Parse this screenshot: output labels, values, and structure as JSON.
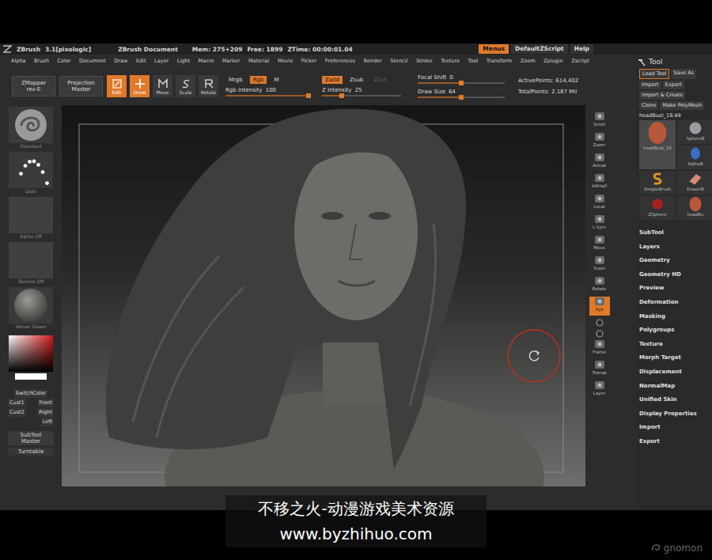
{
  "title_bar": {
    "app": "ZBrush",
    "version": "3.1[pixologic]",
    "document": "ZBrush Document",
    "mem": "Mem: 275+209",
    "free": "Free: 1899",
    "ztime": "ZTime: 00:00:01.04",
    "buttons": [
      {
        "label": "Menus",
        "selected": true
      },
      {
        "label": "DefaultZScript",
        "selected": false
      },
      {
        "label": "Help",
        "selected": false
      }
    ]
  },
  "menu": [
    "Alpha",
    "Brush",
    "Color",
    "Document",
    "Draw",
    "Edit",
    "Layer",
    "Light",
    "Macro",
    "Marker",
    "Material",
    "Movie",
    "Picker",
    "Preferences",
    "Render",
    "Stencil",
    "Stroke",
    "Texture",
    "Tool",
    "Transform",
    "Zoom",
    "Zplugin",
    "Zscript"
  ],
  "top_shelf": {
    "zmapper": [
      "ZMapper",
      "rev-E"
    ],
    "projection": [
      "Projection",
      "Master"
    ],
    "modes": [
      {
        "label": "Edit",
        "selected": true
      },
      {
        "label": "Draw",
        "selected": true
      },
      {
        "label": "Move",
        "selected": false
      },
      {
        "label": "Scale",
        "selected": false
      },
      {
        "label": "Rotate",
        "selected": false
      }
    ],
    "rgb": {
      "modes": [
        {
          "label": "Mrgb",
          "selected": false,
          "disabled": false
        },
        {
          "label": "Rgb",
          "selected": true,
          "disabled": false
        },
        {
          "label": "M",
          "selected": false,
          "disabled": false
        }
      ],
      "slider": {
        "label": "Rgb Intensity",
        "reading": "100",
        "level": 1
      }
    },
    "z": {
      "modes": [
        {
          "label": "Zadd",
          "selected": true,
          "disabled": false
        },
        {
          "label": "Zsub",
          "selected": false,
          "disabled": false
        },
        {
          "label": "Zcut",
          "selected": false,
          "disabled": true
        }
      ],
      "slider": {
        "label": "Z Intensity",
        "reading": "25",
        "level": 0.25
      }
    },
    "focal": [
      {
        "label": "Focal Shift",
        "reading": "0",
        "level": 0.5
      },
      {
        "label": "Draw Size",
        "reading": "64",
        "level": 0.5
      }
    ],
    "stats": [
      "ActivePoints: 614,402",
      "TotalPoints: 2.187 Mil"
    ]
  },
  "left_shelf": {
    "thumbs": [
      {
        "label": "Standard",
        "kind": "brush"
      },
      {
        "label": "Dots",
        "kind": "stroke"
      },
      {
        "label": "Alpha Off",
        "kind": "empty"
      },
      {
        "label": "Texture Off",
        "kind": "empty"
      },
      {
        "label": "Velvet Green",
        "kind": "material"
      }
    ],
    "buttons": [
      {
        "kind": "wide",
        "labels": [
          "SwitchColor"
        ]
      },
      {
        "kind": "pair",
        "labels": [
          "Cust1",
          "Front"
        ]
      },
      {
        "kind": "pair",
        "labels": [
          "Cust2",
          "Right"
        ]
      },
      {
        "kind": "end",
        "labels": [
          "Left"
        ]
      }
    ],
    "master": [
      "SubTool",
      "Master"
    ],
    "turntable": "Turntable"
  },
  "right_shelf": [
    {
      "kind": "button",
      "label": "Scroll",
      "selected": false
    },
    {
      "kind": "button",
      "label": "Zoom",
      "selected": false
    },
    {
      "kind": "button",
      "label": "Actual",
      "selected": false
    },
    {
      "kind": "button",
      "label": "AAHalf",
      "selected": false
    },
    {
      "kind": "button",
      "label": "Local",
      "selected": false
    },
    {
      "kind": "button",
      "label": "L.Sym",
      "selected": false
    },
    {
      "kind": "button",
      "label": "Move",
      "selected": false
    },
    {
      "kind": "button",
      "label": "Scale",
      "selected": false
    },
    {
      "kind": "button",
      "label": "Rotate",
      "selected": false
    },
    {
      "kind": "button",
      "label": "Xyz",
      "selected": true
    },
    {
      "kind": "mini",
      "selected": false
    },
    {
      "kind": "mini",
      "selected": false
    },
    {
      "kind": "button",
      "label": "Frame",
      "selected": false
    },
    {
      "kind": "button",
      "label": "Transp",
      "selected": false
    },
    {
      "kind": "button",
      "label": "Layer",
      "selected": false
    }
  ],
  "tool_panel": {
    "title": "Tool",
    "buttons": [
      [
        "Load Tool",
        "Save As"
      ],
      [
        "Import",
        "Export"
      ],
      [
        "Import & Create"
      ],
      [
        "Clone",
        "Make PolyMesh"
      ]
    ],
    "current": "headBust_18.49",
    "thumbs": [
      {
        "label": "headBust_18",
        "kind": "bust",
        "selected": true
      },
      {
        "label": "SphereB",
        "kind": "sphere",
        "selected": false
      },
      {
        "label": "AlphaB",
        "kind": "alpha",
        "selected": false
      },
      {
        "label": "SimpleBrush",
        "kind": "simple",
        "selected": false
      },
      {
        "label": "EraserB",
        "kind": "eraser",
        "selected": false
      },
      {
        "label": "ZSphere",
        "kind": "zsphere",
        "selected": false
      },
      {
        "label": "headBu",
        "kind": "bust",
        "selected": false
      }
    ],
    "sections": [
      "SubTool",
      "Layers",
      "Geometry",
      "Geometry HD",
      "Preview",
      "Deformation",
      "Masking",
      "Polygroups",
      "Texture",
      "Morph Target",
      "Displacement",
      "NormalMap",
      "Unified Skin",
      "Display Properties",
      "Import",
      "Export"
    ]
  },
  "watermark": [
    "不移之火-动漫游戏美术资源",
    "www.byzhihuo.com"
  ],
  "logo": "gnomon"
}
